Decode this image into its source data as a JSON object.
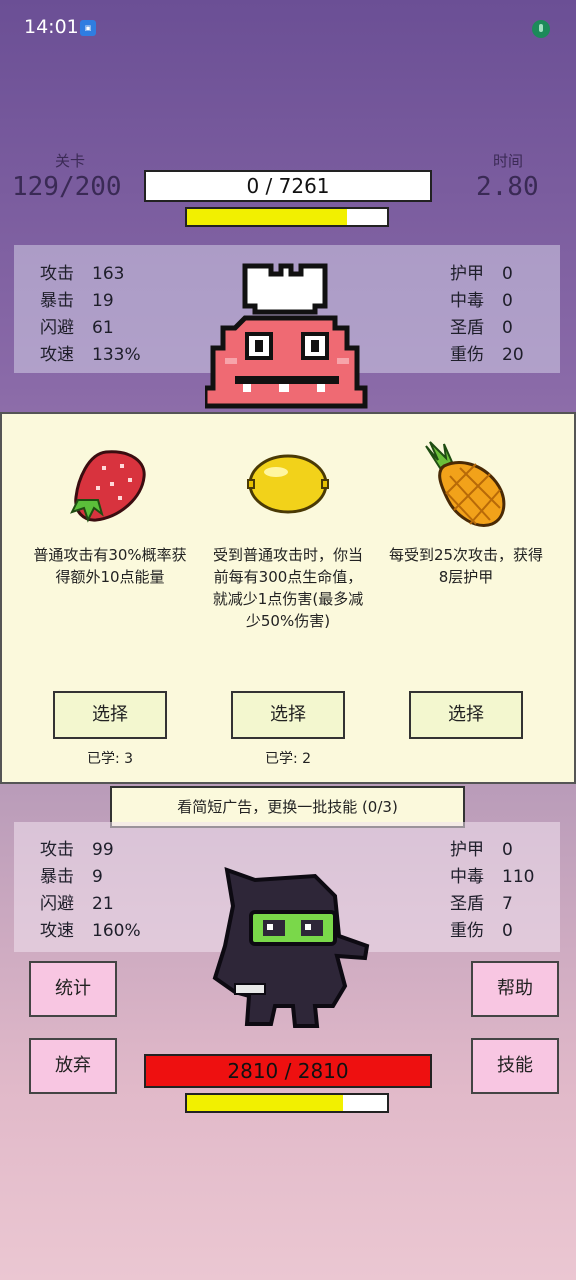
{
  "status_bar": {
    "time": "14:01",
    "notif_icon": "gallery-notification-icon",
    "mic_icon": "mic-icon"
  },
  "header": {
    "level_label": "关卡",
    "level_value": "129/200",
    "time_label": "时间",
    "time_value": "2.80",
    "enemy_hp_text": "0 / 7261",
    "enemy_energy_fraction": 0.8
  },
  "enemy_stats": {
    "left": [
      {
        "k": "攻击",
        "v": "163"
      },
      {
        "k": "暴击",
        "v": "19"
      },
      {
        "k": "闪避",
        "v": "61"
      },
      {
        "k": "攻速",
        "v": "133%"
      }
    ],
    "right": [
      {
        "k": "护甲",
        "v": "0"
      },
      {
        "k": "中毒",
        "v": "0"
      },
      {
        "k": "圣盾",
        "v": "0"
      },
      {
        "k": "重伤",
        "v": "20"
      }
    ]
  },
  "skills": [
    {
      "icon": "strawberry-icon",
      "text": "普通攻击有30%概率获得额外10点能量",
      "button": "选择",
      "learned": "已学: 3"
    },
    {
      "icon": "lemon-icon",
      "text": "受到普通攻击时，你当前每有300点生命值，就减少1点伤害(最多减少50%伤害)",
      "button": "选择",
      "learned": "已学: 2"
    },
    {
      "icon": "pineapple-icon",
      "text": "每受到25次攻击，获得8层护甲",
      "button": "选择",
      "learned": ""
    }
  ],
  "ad_button": "看简短广告，更换一批技能 (0/3)",
  "player_stats": {
    "left": [
      {
        "k": "攻击",
        "v": "99"
      },
      {
        "k": "暴击",
        "v": "9"
      },
      {
        "k": "闪避",
        "v": "21"
      },
      {
        "k": "攻速",
        "v": "160%"
      }
    ],
    "right": [
      {
        "k": "护甲",
        "v": "0"
      },
      {
        "k": "中毒",
        "v": "110"
      },
      {
        "k": "圣盾",
        "v": "7"
      },
      {
        "k": "重伤",
        "v": "0"
      }
    ]
  },
  "buttons": {
    "stats": "统计",
    "give_up": "放弃",
    "help": "帮助",
    "skills": "技能"
  },
  "player": {
    "hp_text": "2810 / 2810",
    "energy_fraction": 0.78
  },
  "colors": {
    "hp_red": "#ee1010",
    "energy_yellow": "#f2f000",
    "skill_panel_bg": "#fbf9dc",
    "pink_button": "#f8c6e2"
  }
}
